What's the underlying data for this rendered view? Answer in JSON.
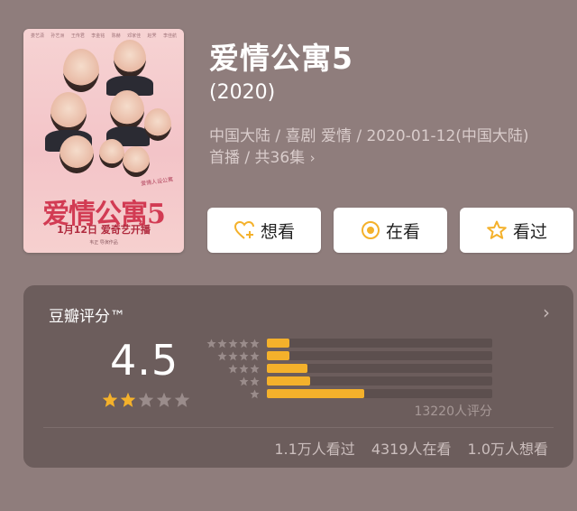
{
  "poster": {
    "title_art": "爱情公寓5",
    "date_line": "1月12日  爱奇艺开播",
    "side_text": "爱情人设公寓",
    "director_line": "韦正  导演作品",
    "credits": [
      "娄艺潇",
      "孙艺洲",
      "王传君",
      "李金铭",
      "陈赫",
      "邓家佳",
      "赵霁",
      "李佳航"
    ]
  },
  "header": {
    "title": "爱情公寓5",
    "year": "(2020)",
    "meta_line1": "中国大陆 / 喜剧 爱情 / 2020-01-12(中国大陆)",
    "meta_line2": "首播 / 共36集",
    "meta_more_icon": "chevron-right-icon"
  },
  "actions": [
    {
      "label": "想看",
      "icon": "heart-plus-icon"
    },
    {
      "label": "在看",
      "icon": "target-icon"
    },
    {
      "label": "看过",
      "icon": "star-outline-icon"
    }
  ],
  "rating": {
    "label": "豆瓣评分™",
    "score": "4.5",
    "stars_filled": 2,
    "stars_total": 5,
    "distribution": [
      {
        "stars": 5,
        "fraction": 0.1
      },
      {
        "stars": 4,
        "fraction": 0.1
      },
      {
        "stars": 3,
        "fraction": 0.18
      },
      {
        "stars": 2,
        "fraction": 0.19
      },
      {
        "stars": 1,
        "fraction": 0.43
      }
    ],
    "count_text": "13220人评分",
    "stats": [
      "1.1万人看过",
      "4319人在看",
      "1.0万人想看"
    ]
  },
  "colors": {
    "background": "#8f7d7c",
    "card": "#6c5d5c",
    "accent": "#f4b12b",
    "star_empty": "#9a8c8b"
  }
}
